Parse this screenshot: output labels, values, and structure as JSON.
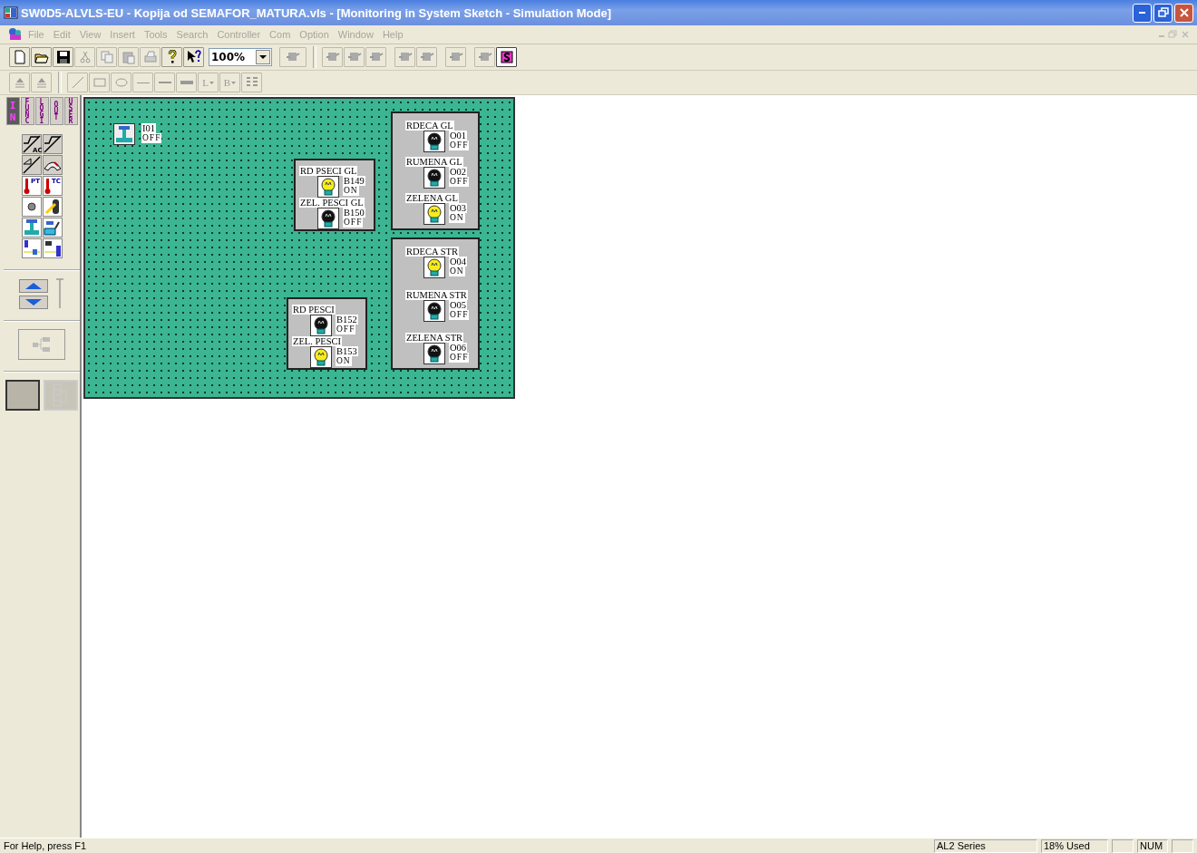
{
  "window": {
    "title": "SW0D5-ALVLS-EU - Kopija od SEMAFOR_MATURA.vls - [Monitoring in System Sketch - Simulation Mode]"
  },
  "menu": [
    {
      "label": "File",
      "disabled": true
    },
    {
      "label": "Edit",
      "disabled": true
    },
    {
      "label": "View",
      "disabled": true
    },
    {
      "label": "Insert",
      "disabled": true
    },
    {
      "label": "Tools",
      "disabled": true
    },
    {
      "label": "Search",
      "disabled": true
    },
    {
      "label": "Controller",
      "disabled": true
    },
    {
      "label": "Com",
      "disabled": true
    },
    {
      "label": "Option",
      "disabled": true
    },
    {
      "label": "Window",
      "disabled": true
    },
    {
      "label": "Help",
      "disabled": true
    }
  ],
  "toolbar": [
    {
      "kind": "new",
      "disabled": false
    },
    {
      "kind": "open",
      "disabled": false
    },
    {
      "kind": "save",
      "disabled": false
    },
    {
      "kind": "cut",
      "disabled": true
    },
    {
      "kind": "copy",
      "disabled": true
    },
    {
      "kind": "paste",
      "disabled": true
    },
    {
      "kind": "print",
      "disabled": true
    },
    {
      "kind": "help",
      "disabled": false
    },
    {
      "kind": "context-help",
      "disabled": false
    },
    {
      "kind": "zoom",
      "value": "100%"
    },
    {
      "kind": "device",
      "disabled": true
    },
    {
      "kind": "sep"
    },
    {
      "kind": "device",
      "disabled": true
    },
    {
      "kind": "device",
      "disabled": true
    },
    {
      "kind": "device",
      "disabled": true
    },
    {
      "kind": "gap"
    },
    {
      "kind": "device",
      "disabled": true
    },
    {
      "kind": "device",
      "disabled": true
    },
    {
      "kind": "gap"
    },
    {
      "kind": "device",
      "disabled": true
    },
    {
      "kind": "gap"
    },
    {
      "kind": "device",
      "disabled": true
    },
    {
      "kind": "simulate",
      "disabled": false
    }
  ],
  "toolbar2": [
    {
      "kind": "up",
      "disabled": true
    },
    {
      "kind": "up",
      "disabled": true
    },
    {
      "kind": "sep"
    },
    {
      "kind": "line",
      "disabled": true
    },
    {
      "kind": "rect",
      "disabled": true
    },
    {
      "kind": "ellipse",
      "disabled": true
    },
    {
      "kind": "thin",
      "disabled": true
    },
    {
      "kind": "medium",
      "disabled": true
    },
    {
      "kind": "thick",
      "disabled": true
    },
    {
      "kind": "text",
      "label": "L",
      "disabled": true
    },
    {
      "kind": "text",
      "label": "B",
      "disabled": true
    },
    {
      "kind": "align",
      "disabled": true
    }
  ],
  "palette_tabs": [
    {
      "label": "IN",
      "selected": true
    },
    {
      "label": "FUNC",
      "selected": false
    },
    {
      "label": "LOGI",
      "selected": false
    },
    {
      "label": "OUT",
      "selected": false
    },
    {
      "label": "USER",
      "selected": false
    }
  ],
  "palette_icons": [
    {
      "kind": "step",
      "text": "AC"
    },
    {
      "kind": "step"
    },
    {
      "kind": "ramp"
    },
    {
      "kind": "gauge"
    },
    {
      "kind": "thermo",
      "text": "PT"
    },
    {
      "kind": "thermo",
      "text": "TC"
    },
    {
      "kind": "dot"
    },
    {
      "kind": "lever"
    },
    {
      "kind": "push"
    },
    {
      "kind": "panel"
    },
    {
      "kind": "plug"
    },
    {
      "kind": "sensor"
    }
  ],
  "canvas": {
    "input": {
      "address": "I01",
      "state": "OFF"
    },
    "panels": [
      {
        "lamps": [
          {
            "label": "RD PSECI GL",
            "address": "B149",
            "state": "ON",
            "lit": true
          },
          {
            "label": "ZEL. PESCI GL",
            "address": "B150",
            "state": "OFF",
            "lit": false
          }
        ]
      },
      {
        "lamps": [
          {
            "label": "RDECA GL",
            "address": "O01",
            "state": "OFF",
            "lit": false
          },
          {
            "label": "RUMENA GL",
            "address": "O02",
            "state": "OFF",
            "lit": false
          },
          {
            "label": "ZELENA GL",
            "address": "O03",
            "state": "ON",
            "lit": true
          }
        ]
      },
      {
        "lamps": [
          {
            "label": "RD PESCI",
            "address": "B152",
            "state": "OFF",
            "lit": false
          },
          {
            "label": "ZEL. PESCI",
            "address": "B153",
            "state": "ON",
            "lit": true
          }
        ]
      },
      {
        "lamps": [
          {
            "label": "RDECA STR",
            "address": "O04",
            "state": "ON",
            "lit": true
          },
          {
            "label": "RUMENA STR",
            "address": "O05",
            "state": "OFF",
            "lit": false
          },
          {
            "label": "ZELENA STR",
            "address": "O06",
            "state": "OFF",
            "lit": false
          }
        ]
      }
    ]
  },
  "status_bar": {
    "help": "For Help, press F1",
    "series": "AL2 Series",
    "memory": "18% Used",
    "num": "NUM"
  }
}
